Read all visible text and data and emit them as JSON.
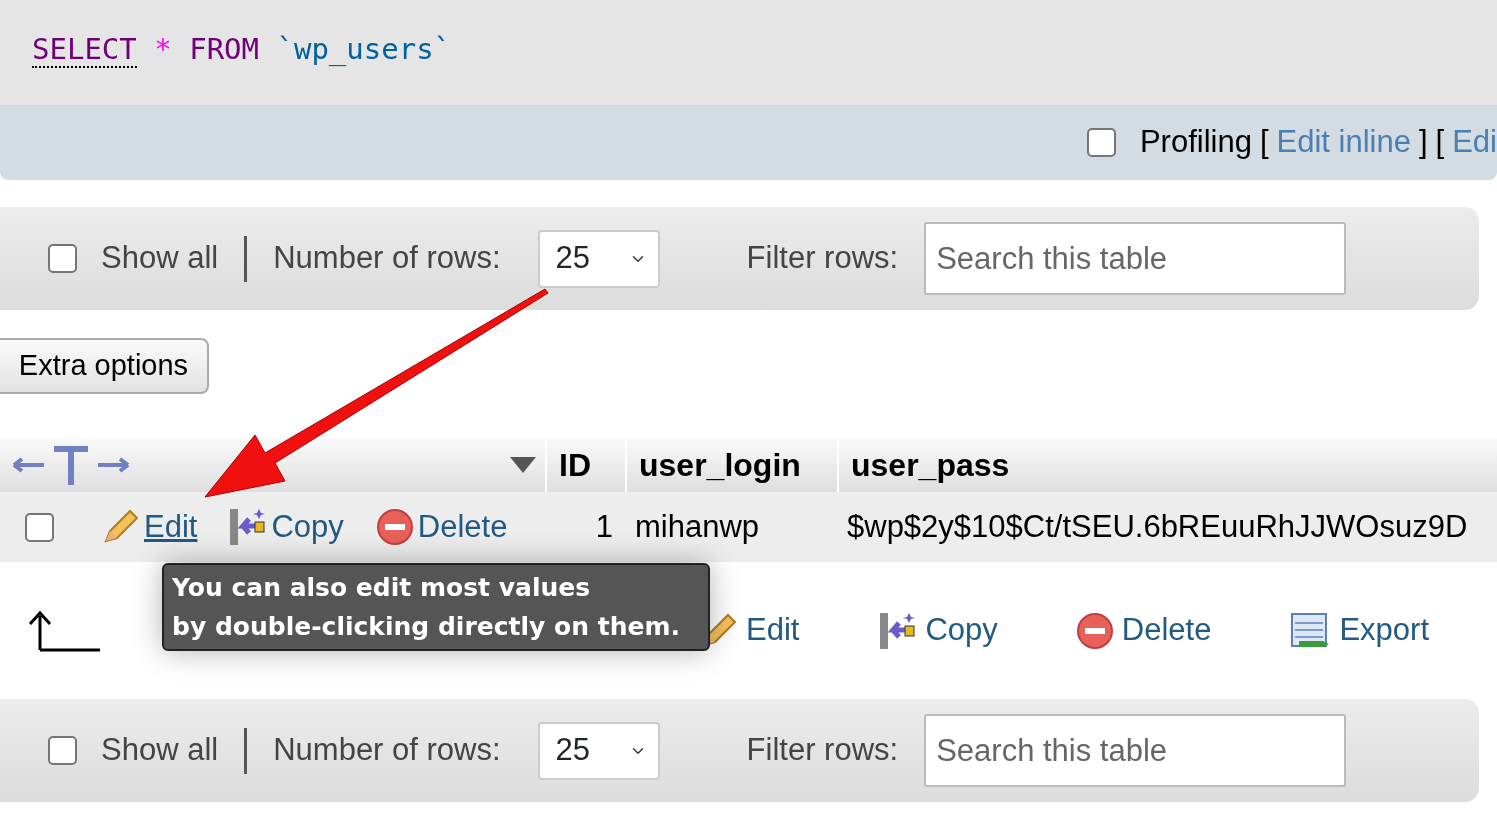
{
  "sql": {
    "keyword": "SELECT",
    "star": "*",
    "from": "FROM",
    "table": "`wp_users`"
  },
  "profiling": {
    "checked": false,
    "label": "Profiling",
    "tokens": [
      {
        "kind": "bracket",
        "text": "["
      },
      {
        "kind": "link",
        "text": "Edit inline"
      },
      {
        "kind": "bracket",
        "text": "]"
      },
      {
        "kind": "bracket",
        "text": "["
      },
      {
        "kind": "partial_link",
        "text": "Edi"
      }
    ]
  },
  "nav_top": {
    "show_all": {
      "label": "Show all",
      "checked": false
    },
    "rows_label": "Number of rows:",
    "rows_value": "25",
    "filter_label": "Filter rows:",
    "search": {
      "placeholder": "Search this table"
    }
  },
  "extra_options": "Extra options",
  "table": {
    "columns": [
      "ID",
      "user_login",
      "user_pass"
    ],
    "rows": [
      {
        "selected": false,
        "actions": [
          {
            "kind": "edit",
            "label": "Edit",
            "hovered": true
          },
          {
            "kind": "copy",
            "label": "Copy",
            "hovered": false
          },
          {
            "kind": "delete",
            "label": "Delete",
            "hovered": false
          }
        ],
        "cells": [
          "1",
          "mihanwp",
          "$wp$2y$10$Ct/tSEU.6bREuuRhJJWOsuz9D"
        ]
      }
    ]
  },
  "bulk_actions": [
    {
      "kind": "edit",
      "label": "Edit"
    },
    {
      "kind": "copy",
      "label": "Copy"
    },
    {
      "kind": "delete",
      "label": "Delete"
    },
    {
      "kind": "export",
      "label": "Export"
    }
  ],
  "tooltip": "You can also edit most values\nby double-clicking directly on them.",
  "nav_bottom": {
    "show_all": {
      "label": "Show all",
      "checked": false
    },
    "rows_label": "Number of rows:",
    "rows_value": "25",
    "filter_label": "Filter rows:",
    "search": {
      "placeholder": "Search this table"
    }
  }
}
